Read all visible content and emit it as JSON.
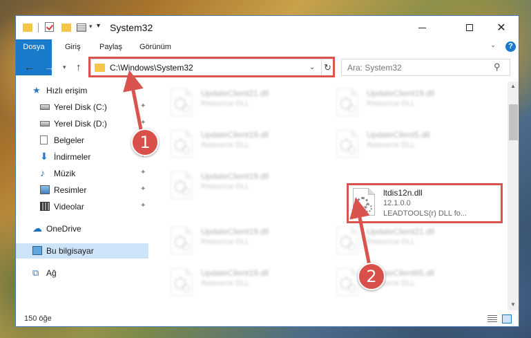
{
  "window": {
    "title": "System32"
  },
  "ribbon": {
    "tabs": [
      "Dosya",
      "Giriş",
      "Paylaş",
      "Görünüm"
    ],
    "help": "?"
  },
  "address": {
    "path": "C:\\Windows\\System32",
    "search_placeholder": "Ara: System32"
  },
  "sidebar": {
    "items": [
      {
        "label": "Hızlı erişim",
        "icon": "star-icon"
      },
      {
        "label": "Yerel Disk (C:)",
        "icon": "disk-icon",
        "pinned": true
      },
      {
        "label": "Yerel Disk (D:)",
        "icon": "disk-icon",
        "pinned": true
      },
      {
        "label": "Belgeler",
        "icon": "document-icon",
        "pinned": true
      },
      {
        "label": "İndirmeler",
        "icon": "download-icon",
        "pinned": true
      },
      {
        "label": "Müzik",
        "icon": "music-icon",
        "pinned": true
      },
      {
        "label": "Resimler",
        "icon": "pictures-icon",
        "pinned": true
      },
      {
        "label": "Videolar",
        "icon": "videos-icon",
        "pinned": true
      },
      {
        "label": "OneDrive",
        "icon": "cloud-icon"
      },
      {
        "label": "Bu bilgisayar",
        "icon": "computer-icon",
        "selected": true
      },
      {
        "label": "Ağ",
        "icon": "network-icon"
      }
    ]
  },
  "files": [
    {
      "name": "UpdateClient21.dll",
      "desc": "Resource DLL",
      "blurred": true
    },
    {
      "name": "UpdateClient19.dll",
      "desc": "Resource DLL",
      "blurred": true
    },
    {
      "name": "UpdateClient19.dll",
      "desc": "Resource DLL",
      "blurred": true
    },
    {
      "name": "UpdateClient5.dll",
      "desc": "Resource DLL",
      "blurred": true
    },
    {
      "name": "UpdateClient19.dll",
      "desc": "Resource DLL",
      "blurred": true
    },
    {
      "name": "ltdis12n.dll",
      "version": "12.1.0.0",
      "desc": "LEADTOOLS(r) DLL fo...",
      "blurred": false
    },
    {
      "name": "UpdateClient19.dll",
      "desc": "Resource DLL",
      "blurred": true
    },
    {
      "name": "UpdateClient21.dll",
      "desc": "Resource DLL",
      "blurred": true
    },
    {
      "name": "UpdateClient19.dll",
      "desc": "Resource DLL",
      "blurred": true
    },
    {
      "name": "UpdateClient65.dll",
      "desc": "Resource DLL",
      "blurred": true
    }
  ],
  "status": {
    "count": "150 öğe"
  },
  "annotations": {
    "step1": "1",
    "step2": "2",
    "color": "#d9534f"
  }
}
